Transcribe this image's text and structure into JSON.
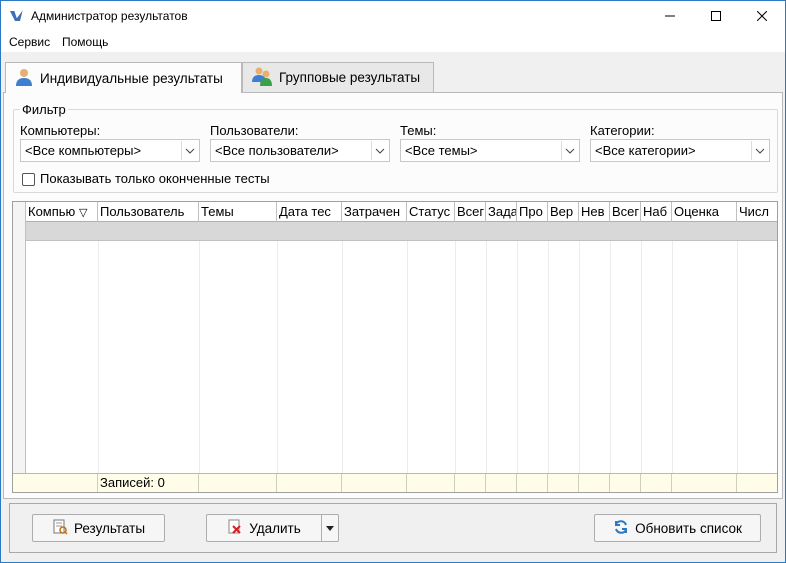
{
  "window": {
    "title": "Администратор результатов"
  },
  "menu": {
    "items": [
      "Сервис",
      "Помощь"
    ]
  },
  "tabs": [
    {
      "label": "Индивидуальные результаты",
      "active": true,
      "icon": "user-icon"
    },
    {
      "label": "Групповые результаты",
      "active": false,
      "icon": "users-icon"
    }
  ],
  "filter": {
    "legend": "Фильтр",
    "computers": {
      "label": "Компьютеры:",
      "value": "<Все компьютеры>"
    },
    "users": {
      "label": "Пользователи:",
      "value": "<Все пользователи>"
    },
    "topics": {
      "label": "Темы:",
      "value": "<Все темы>"
    },
    "categories": {
      "label": "Категории:",
      "value": "<Все категории>"
    },
    "only_finished": {
      "label": "Показывать только оконченные тесты",
      "checked": false
    }
  },
  "grid": {
    "columns": [
      "Компью",
      "Пользователь",
      "Темы",
      "Дата тес",
      "Затрачен",
      "Статус",
      "Всег",
      "Зада",
      "Про",
      "Вер",
      "Нев",
      "Всег",
      "Наб",
      "Оценка",
      "Числ"
    ],
    "sort_indicator": "▽",
    "records_label": "Записей: 0"
  },
  "buttons": {
    "results": "Результаты",
    "delete": "Удалить",
    "refresh": "Обновить список"
  },
  "colors": {
    "accent": "#2b79c2",
    "footer_bg": "#fffde8",
    "filter_row_bg": "#d8d8d8"
  }
}
